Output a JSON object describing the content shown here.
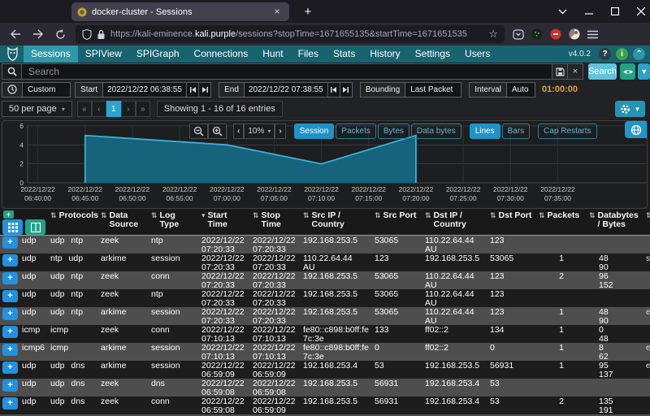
{
  "browser": {
    "tab_title": "docker-cluster - Sessions",
    "url": {
      "prefix": "https://kali-eminence.",
      "domain": "kali.purple",
      "path": "/sessions?stopTime=1671655135&startTime=1671651535"
    }
  },
  "navbar": {
    "version": "v4.0.2",
    "active_item": "Sessions",
    "items": [
      "Sessions",
      "SPIView",
      "SPIGraph",
      "Connections",
      "Hunt",
      "Files",
      "Stats",
      "History",
      "Settings",
      "Users"
    ]
  },
  "search": {
    "placeholder": "Search",
    "search_button": "Search"
  },
  "timebar": {
    "range_value": "Custom",
    "start_label": "Start",
    "start_value": "2022/12/22 06:38:55",
    "end_label": "End",
    "end_value": "2022/12/22 07:38:55",
    "bounding_label": "Bounding",
    "bounding_value": "Last Packet",
    "interval_label": "Interval",
    "interval_value": "Auto",
    "duration": "01:00:00"
  },
  "pager": {
    "per_page": "50 per page",
    "first": "«",
    "prev": "‹",
    "page": "1",
    "next": "›",
    "last": "»",
    "summary": "Showing 1 - 16 of 16 entries"
  },
  "chart_toolbar": {
    "zoom_value": "10%",
    "series_buttons": [
      {
        "label": "Session",
        "active": true
      },
      {
        "label": "Packets",
        "active": false
      },
      {
        "label": "Bytes",
        "active": false
      },
      {
        "label": "Data bytes",
        "active": false
      }
    ],
    "style_buttons": [
      {
        "label": "Lines",
        "active": true
      },
      {
        "label": "Bars",
        "active": false
      }
    ],
    "extra_buttons": [
      {
        "label": "Cap Restarts",
        "active": false
      }
    ]
  },
  "chart_data": {
    "type": "area",
    "series_name": "Session",
    "ylim": [
      0,
      6
    ],
    "y_ticks": [
      0,
      2,
      4,
      6
    ],
    "x_domain": [
      "06:38:55",
      "07:44:20"
    ],
    "tick_date": "2022/12/22",
    "tick_times": [
      "06:40:00",
      "06:45:00",
      "06:50:00",
      "06:55:00",
      "07:00:00",
      "07:05:00",
      "07:10:00",
      "07:15:00",
      "07:20:00",
      "07:25:00",
      "07:30:00",
      "07:35:00"
    ],
    "points": [
      [
        "06:45:00",
        0
      ],
      [
        "06:45:00",
        5
      ],
      [
        "07:00:00",
        4
      ],
      [
        "07:10:00",
        2
      ],
      [
        "07:20:00",
        5
      ],
      [
        "07:20:00",
        0
      ]
    ],
    "colors": {
      "fill": "#16637c",
      "stroke": "#3eafd8"
    }
  },
  "table": {
    "sort_icon_both": "⇅",
    "sort_icon_desc": "▾",
    "headers": [
      {
        "label": "Protocols",
        "sort": "both"
      },
      {
        "label": "Data Source",
        "sort": "both"
      },
      {
        "label": "Log Type",
        "sort": "both"
      },
      {
        "label": "Start Time",
        "sort": "desc"
      },
      {
        "label": "Stop Time",
        "sort": "both"
      },
      {
        "label": "Src IP / Country",
        "sort": "both"
      },
      {
        "label": "Src Port",
        "sort": "both"
      },
      {
        "label": "Dst IP / Country",
        "sort": "both"
      },
      {
        "label": "Dst Port",
        "sort": "both"
      },
      {
        "label": "Packets",
        "sort": "both"
      },
      {
        "label": "Databytes / Bytes",
        "sort": "both"
      }
    ],
    "rows": [
      {
        "proto": "udp",
        "protocols": "udp ntp",
        "data_source": "zeek",
        "log_type": "ntp",
        "start": "2022/12/22 07:20:33",
        "stop": "2022/12/22 07:20:33",
        "src_ip": "192.168.253.5",
        "src_country": "",
        "src_port": "53065",
        "dst_ip": "110.22.64.44",
        "dst_country": "AU",
        "dst_port": "123",
        "packets": "",
        "databytes": "",
        "bytes": "",
        "clip": ""
      },
      {
        "proto": "udp",
        "protocols": "ntp udp",
        "data_source": "arkime",
        "log_type": "session",
        "start": "2022/12/22 07:20:33",
        "stop": "2022/12/22 07:20:33",
        "src_ip": "110.22.64.44",
        "src_country": "AU",
        "src_port": "123",
        "dst_ip": "192.168.253.5",
        "dst_country": "",
        "dst_port": "53065",
        "packets": "1",
        "databytes": "48",
        "bytes": "90",
        "clip": "s"
      },
      {
        "proto": "udp",
        "protocols": "udp ntp",
        "data_source": "zeek",
        "log_type": "conn",
        "start": "2022/12/22 07:20:33",
        "stop": "2022/12/22 07:20:33",
        "src_ip": "192.168.253.5",
        "src_country": "",
        "src_port": "53065",
        "dst_ip": "110.22.64.44",
        "dst_country": "AU",
        "dst_port": "123",
        "packets": "2",
        "databytes": "96",
        "bytes": "152",
        "clip": ""
      },
      {
        "proto": "udp",
        "protocols": "udp ntp",
        "data_source": "zeek",
        "log_type": "ntp",
        "start": "2022/12/22 07:20:33",
        "stop": "2022/12/22 07:20:33",
        "src_ip": "192.168.253.5",
        "src_country": "",
        "src_port": "53065",
        "dst_ip": "110.22.64.44",
        "dst_country": "AU",
        "dst_port": "123",
        "packets": "",
        "databytes": "",
        "bytes": "",
        "clip": ""
      },
      {
        "proto": "udp",
        "protocols": "udp ntp",
        "data_source": "arkime",
        "log_type": "session",
        "start": "2022/12/22 07:20:33",
        "stop": "2022/12/22 07:20:33",
        "src_ip": "192.168.253.5",
        "src_country": "",
        "src_port": "53065",
        "dst_ip": "110.22.64.44",
        "dst_country": "AU",
        "dst_port": "123",
        "packets": "1",
        "databytes": "48",
        "bytes": "90",
        "clip": "e"
      },
      {
        "proto": "icmp",
        "protocols": "icmp",
        "data_source": "zeek",
        "log_type": "conn",
        "start": "2022/12/22 07:10:13",
        "stop": "2022/12/22 07:10:13",
        "src_ip": "fe80::c898:b0ff:fe7c:3e",
        "src_country": "",
        "src_port": "133",
        "dst_ip": "ff02::2",
        "dst_country": "",
        "dst_port": "134",
        "packets": "1",
        "databytes": "0",
        "bytes": "48",
        "clip": ""
      },
      {
        "proto": "icmp6",
        "protocols": "icmp",
        "data_source": "arkime",
        "log_type": "session",
        "start": "2022/12/22 07:10:13",
        "stop": "2022/12/22 07:10:13",
        "src_ip": "fe80::c898:b0ff:fe7c:3e",
        "src_country": "",
        "src_port": "0",
        "dst_ip": "ff02::2",
        "dst_country": "",
        "dst_port": "0",
        "packets": "1",
        "databytes": "8",
        "bytes": "62",
        "clip": "e"
      },
      {
        "proto": "udp",
        "protocols": "udp dns",
        "data_source": "arkime",
        "log_type": "session",
        "start": "2022/12/22 06:59:09",
        "stop": "2022/12/22 06:59:09",
        "src_ip": "192.168.253.4",
        "src_country": "",
        "src_port": "53",
        "dst_ip": "192.168.253.5",
        "dst_country": "",
        "dst_port": "56931",
        "packets": "1",
        "databytes": "95",
        "bytes": "137",
        "clip": "e"
      },
      {
        "proto": "udp",
        "protocols": "udp dns",
        "data_source": "zeek",
        "log_type": "dns",
        "start": "2022/12/22 06:59:08",
        "stop": "2022/12/22 06:59:08",
        "src_ip": "192.168.253.5",
        "src_country": "",
        "src_port": "56931",
        "dst_ip": "192.168.253.4",
        "dst_country": "",
        "dst_port": "53",
        "packets": "",
        "databytes": "",
        "bytes": "",
        "clip": ""
      },
      {
        "proto": "udp",
        "protocols": "udp dns",
        "data_source": "zeek",
        "log_type": "conn",
        "start": "2022/12/22 06:59:08",
        "stop": "2022/12/22 06:59:09",
        "src_ip": "192.168.253.5",
        "src_country": "",
        "src_port": "56931",
        "dst_ip": "192.168.253.4",
        "dst_country": "",
        "dst_port": "53",
        "packets": "2",
        "databytes": "135",
        "bytes": "191",
        "clip": ""
      }
    ]
  }
}
